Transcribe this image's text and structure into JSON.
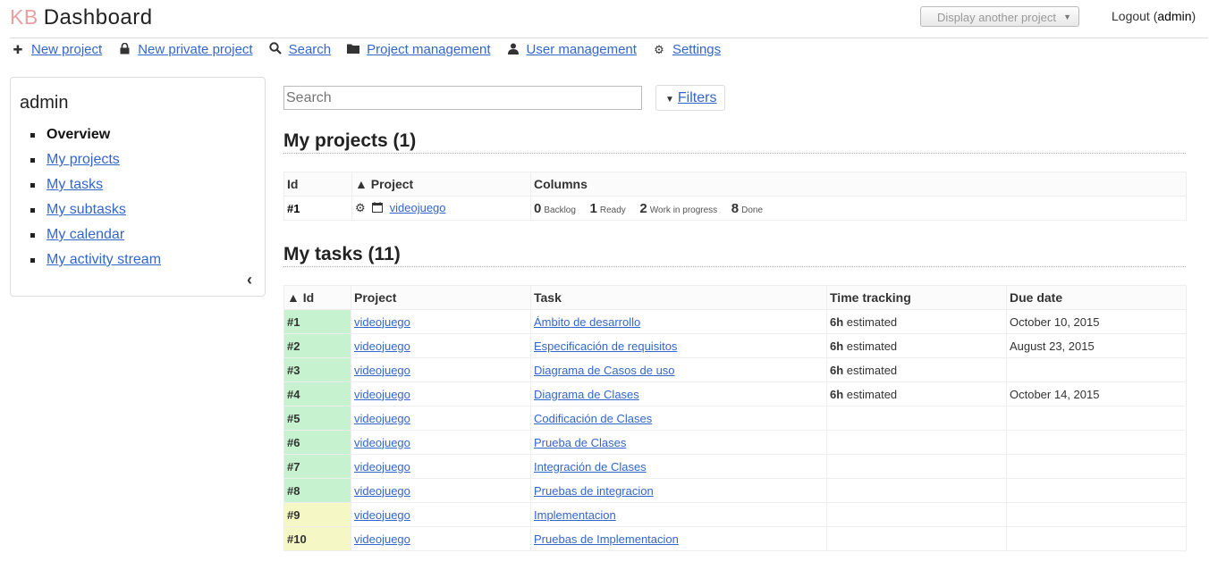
{
  "header": {
    "logo": "KB",
    "title": "Dashboard",
    "project_select": "Display another project",
    "logout_label": "Logout",
    "user": "admin"
  },
  "menu": [
    {
      "icon": "plus-icon",
      "label": "New project"
    },
    {
      "icon": "lock-icon",
      "label": "New private project"
    },
    {
      "icon": "search-icon",
      "label": "Search"
    },
    {
      "icon": "folder-icon",
      "label": "Project management"
    },
    {
      "icon": "user-icon",
      "label": "User management"
    },
    {
      "icon": "gear-icon",
      "label": "Settings"
    }
  ],
  "sidebar": {
    "title": "admin",
    "items": [
      {
        "label": "Overview",
        "active": true
      },
      {
        "label": "My projects"
      },
      {
        "label": "My tasks"
      },
      {
        "label": "My subtasks"
      },
      {
        "label": "My calendar"
      },
      {
        "label": "My activity stream"
      }
    ]
  },
  "search": {
    "placeholder": "Search"
  },
  "filters_label": "Filters",
  "projects": {
    "title": "My projects (1)",
    "headers": [
      "Id",
      "▲ Project",
      "Columns"
    ],
    "rows": [
      {
        "id": "#1",
        "name": "videojuego",
        "columns": [
          {
            "count": "0",
            "name": "Backlog"
          },
          {
            "count": "1",
            "name": "Ready"
          },
          {
            "count": "2",
            "name": "Work in progress"
          },
          {
            "count": "8",
            "name": "Done"
          }
        ]
      }
    ]
  },
  "tasks": {
    "title": "My tasks (11)",
    "headers": [
      "▲ Id",
      "Project",
      "Task",
      "Time tracking",
      "Due date"
    ],
    "colors": {
      "green": "#c6f2cf",
      "yellow": "#f5f7c4"
    },
    "rows": [
      {
        "id": "#1",
        "color": "green",
        "project": "videojuego",
        "task": "Ámbito de desarrollo",
        "hours": "6h",
        "estimate": "estimated",
        "due": "October 10, 2015"
      },
      {
        "id": "#2",
        "color": "green",
        "project": "videojuego",
        "task": "Especificación de requisitos",
        "hours": "6h",
        "estimate": "estimated",
        "due": "August 23, 2015"
      },
      {
        "id": "#3",
        "color": "green",
        "project": "videojuego",
        "task": "Diagrama de Casos de uso",
        "hours": "6h",
        "estimate": "estimated",
        "due": ""
      },
      {
        "id": "#4",
        "color": "green",
        "project": "videojuego",
        "task": "Diagrama de Clases",
        "hours": "6h",
        "estimate": "estimated",
        "due": "October 14, 2015"
      },
      {
        "id": "#5",
        "color": "green",
        "project": "videojuego",
        "task": "Codificación de Clases",
        "hours": "",
        "estimate": "",
        "due": ""
      },
      {
        "id": "#6",
        "color": "green",
        "project": "videojuego",
        "task": "Prueba de Clases",
        "hours": "",
        "estimate": "",
        "due": ""
      },
      {
        "id": "#7",
        "color": "green",
        "project": "videojuego",
        "task": "Integración de Clases",
        "hours": "",
        "estimate": "",
        "due": ""
      },
      {
        "id": "#8",
        "color": "green",
        "project": "videojuego",
        "task": "Pruebas de integracion",
        "hours": "",
        "estimate": "",
        "due": ""
      },
      {
        "id": "#9",
        "color": "yellow",
        "project": "videojuego",
        "task": "Implementacion",
        "hours": "",
        "estimate": "",
        "due": ""
      },
      {
        "id": "#10",
        "color": "yellow",
        "project": "videojuego",
        "task": "Pruebas de Implementacion",
        "hours": "",
        "estimate": "",
        "due": ""
      }
    ]
  }
}
